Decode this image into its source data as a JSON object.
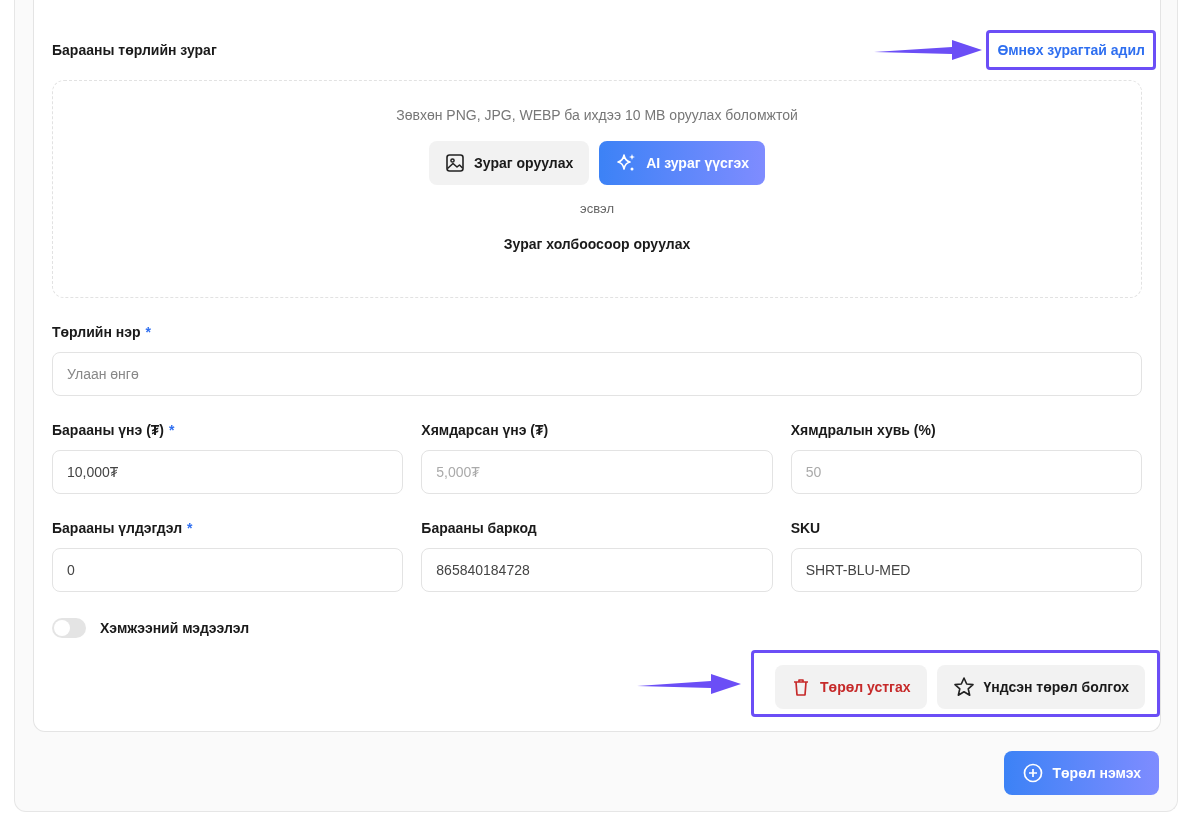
{
  "image_section": {
    "title": "Барааны төрлийн зураг",
    "same_image_link": "Өмнөх зурагтай адил",
    "hint": "Зөвхөн PNG, JPG, WEBP ба ихдээ 10 MB оруулах боломжтой",
    "upload_button": "Зураг оруулах",
    "ai_button": "AI зураг үүсгэх",
    "or_text": "эсвэл",
    "url_link": "Зураг холбоосоор оруулах"
  },
  "name_field": {
    "label": "Төрлийн нэр",
    "required": true,
    "placeholder": "Улаан өнгө"
  },
  "field_rows": [
    [
      {
        "label": "Барааны үнэ (₮)",
        "required": true,
        "value": "10,000₮",
        "disabled": false
      },
      {
        "label": "Хямдарсан үнэ (₮)",
        "required": false,
        "placeholder": "5,000₮",
        "disabled": true
      },
      {
        "label": "Хямдралын хувь (%)",
        "required": false,
        "placeholder": "50",
        "disabled": true
      }
    ],
    [
      {
        "label": "Барааны үлдэгдэл",
        "required": true,
        "value": "0",
        "disabled": false
      },
      {
        "label": "Барааны баркод",
        "required": false,
        "value": "865840184728",
        "disabled": false
      },
      {
        "label": "SKU",
        "required": false,
        "value": "SHRT-BLU-MED",
        "disabled": false
      }
    ]
  ],
  "required_mark": "*",
  "size_toggle": {
    "label": "Хэмжээний мэдээлэл",
    "on": false
  },
  "actions": [
    {
      "kind": "delete",
      "label": "Төрөл устгах"
    },
    {
      "kind": "main",
      "label": "Үндсэн төрөл болгох"
    }
  ],
  "add_button": "Төрөл нэмэх"
}
